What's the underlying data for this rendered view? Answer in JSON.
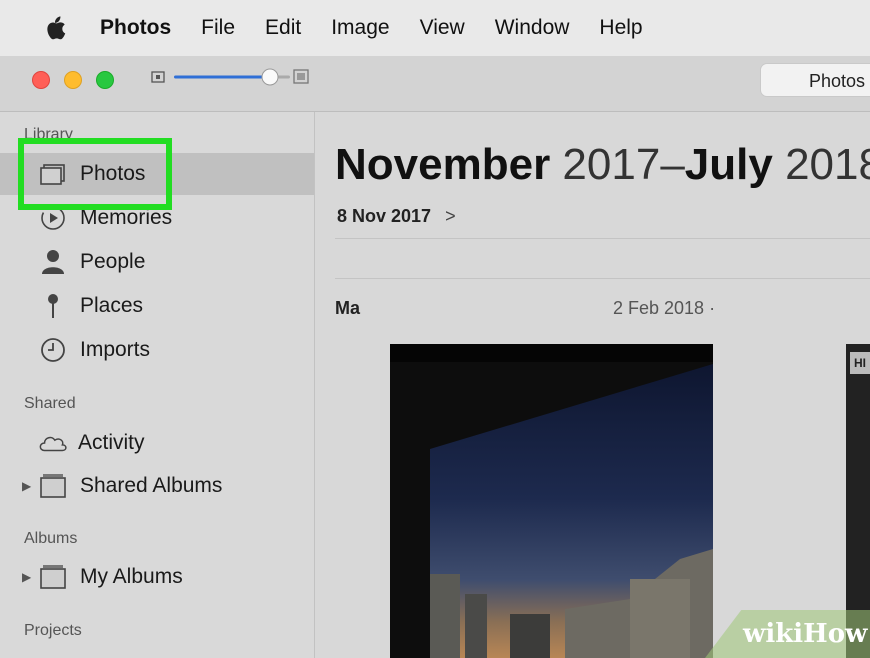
{
  "menubar": {
    "app_name": "Photos",
    "menus": [
      "File",
      "Edit",
      "Image",
      "View",
      "Window",
      "Help"
    ]
  },
  "toolbar": {
    "search_label": "Photos",
    "zoom_level": 0.9,
    "traffic_lights": {
      "close": "#ff5f57",
      "minimize": "#febc2e",
      "zoom": "#28c840"
    }
  },
  "sidebar": {
    "library_heading": "Library",
    "library_items": [
      {
        "label": "Photos",
        "icon": "photos-icon"
      },
      {
        "label": "Memories",
        "icon": "memories-icon"
      },
      {
        "label": "People",
        "icon": "person-icon"
      },
      {
        "label": "Places",
        "icon": "pin-icon"
      },
      {
        "label": "Imports",
        "icon": "clock-icon"
      }
    ],
    "shared_heading": "Shared",
    "shared_items": [
      {
        "label": "Activity",
        "icon": "cloud-icon"
      },
      {
        "label": "Shared Albums",
        "icon": "album-icon"
      }
    ],
    "albums_heading": "Albums",
    "album_items": [
      {
        "label": "My Albums",
        "icon": "album-icon"
      }
    ],
    "projects_heading": "Projects"
  },
  "main": {
    "range_start_month": "November",
    "range_start_year": "2017",
    "range_dash": "–",
    "range_end_month": "July",
    "range_end_year": "2018",
    "sub_date": "8 Nov 2017",
    "group_label": "Ma",
    "group_date": "2 Feb 2018 ·",
    "hdr_badge": "HI"
  },
  "watermark": "wikiHow",
  "colors": {
    "highlight": "#22dd22",
    "accent": "#2f6fd6"
  }
}
